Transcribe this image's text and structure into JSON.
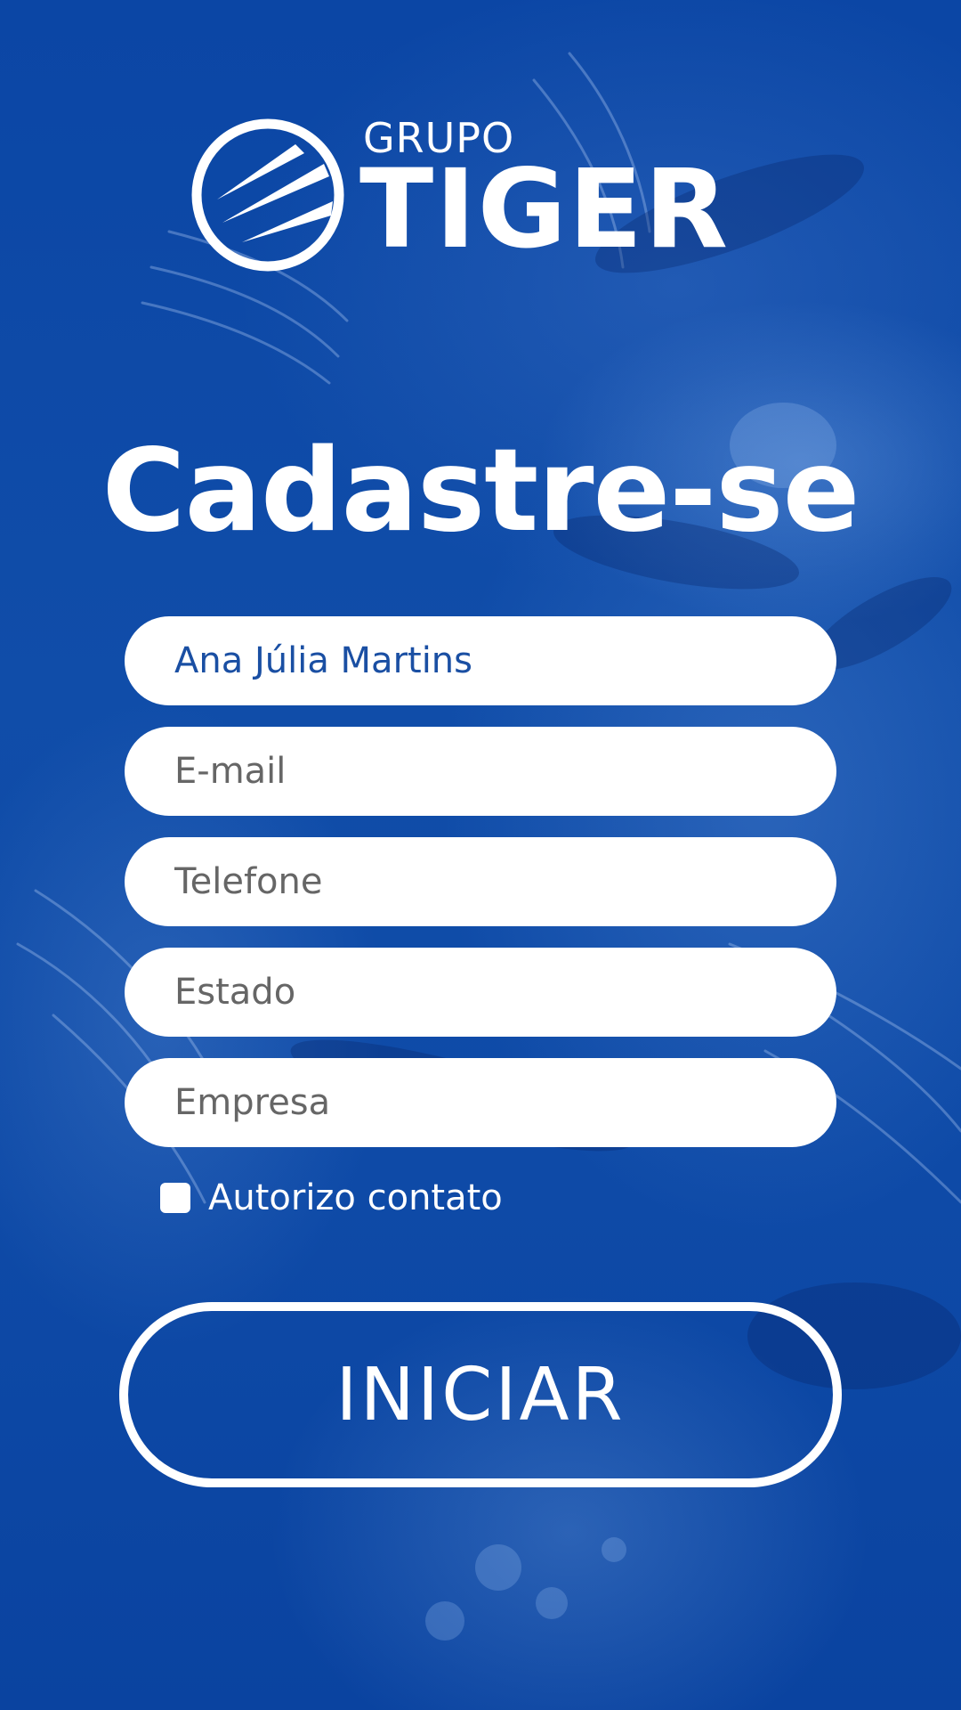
{
  "brand": {
    "grupo": "GRUPO",
    "name": "TIGER",
    "emblem_icon": "tiger-stripes-emblem-icon"
  },
  "title": "Cadastre-se",
  "form": {
    "name": {
      "value": "Ana Júlia Martins",
      "placeholder": ""
    },
    "email": {
      "value": "",
      "placeholder": "E-mail"
    },
    "phone": {
      "value": "",
      "placeholder": "Telefone"
    },
    "state": {
      "value": "",
      "placeholder": "Estado"
    },
    "company": {
      "value": "",
      "placeholder": "Empresa"
    },
    "consent": {
      "label": "Autorizo contato",
      "checked": false
    }
  },
  "actions": {
    "start_label": "INICIAR"
  },
  "colors": {
    "background": "#0d47a6",
    "field_background": "#ffffff",
    "field_text": "#1a4fa3",
    "placeholder_text": "#666666",
    "foreground": "#ffffff"
  }
}
